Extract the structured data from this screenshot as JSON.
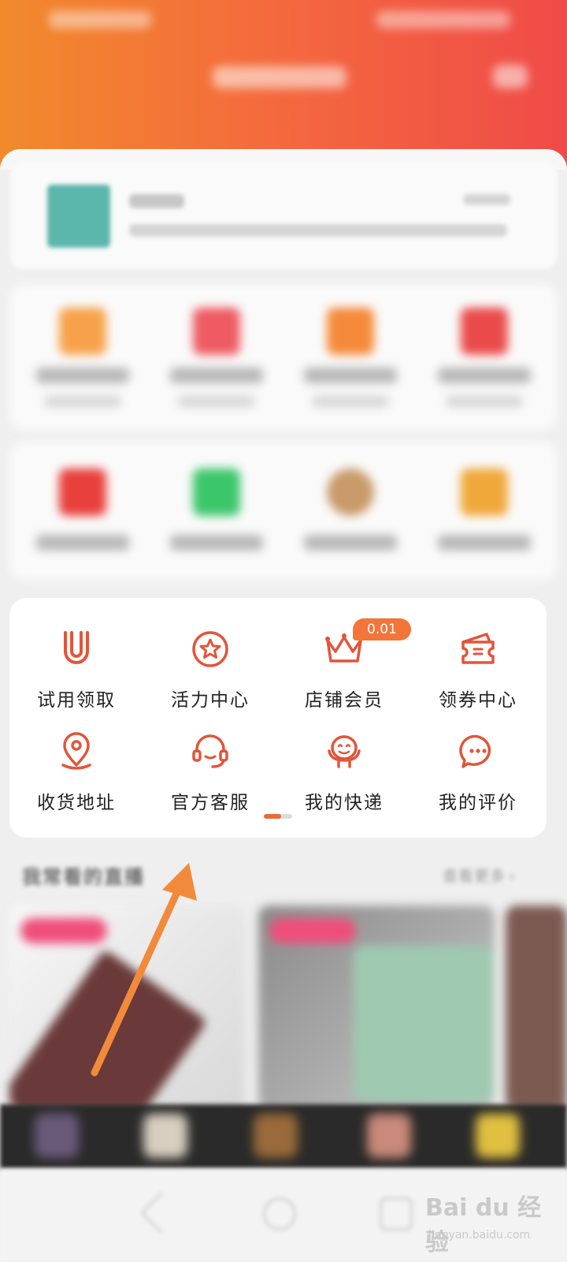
{
  "tools": {
    "items": [
      {
        "label": "试用领取",
        "icon": "u-icon"
      },
      {
        "label": "活力中心",
        "icon": "star-icon"
      },
      {
        "label": "店铺会员",
        "icon": "crown-icon"
      },
      {
        "label": "领券中心",
        "icon": "coupon-icon"
      },
      {
        "label": "收货地址",
        "icon": "location-pin-icon"
      },
      {
        "label": "官方客服",
        "icon": "headset-icon"
      },
      {
        "label": "我的快递",
        "icon": "courier-icon"
      },
      {
        "label": "我的评价",
        "icon": "chat-bubble-icon"
      }
    ],
    "badge": "0.01",
    "accent_color": "#e2553a"
  },
  "live": {
    "title": "我常看的直播",
    "more_label": "查看更多",
    "more_chevron": "›"
  },
  "watermark": {
    "text": "Bai du 经验",
    "sub": "jingyan.baidu.com"
  }
}
